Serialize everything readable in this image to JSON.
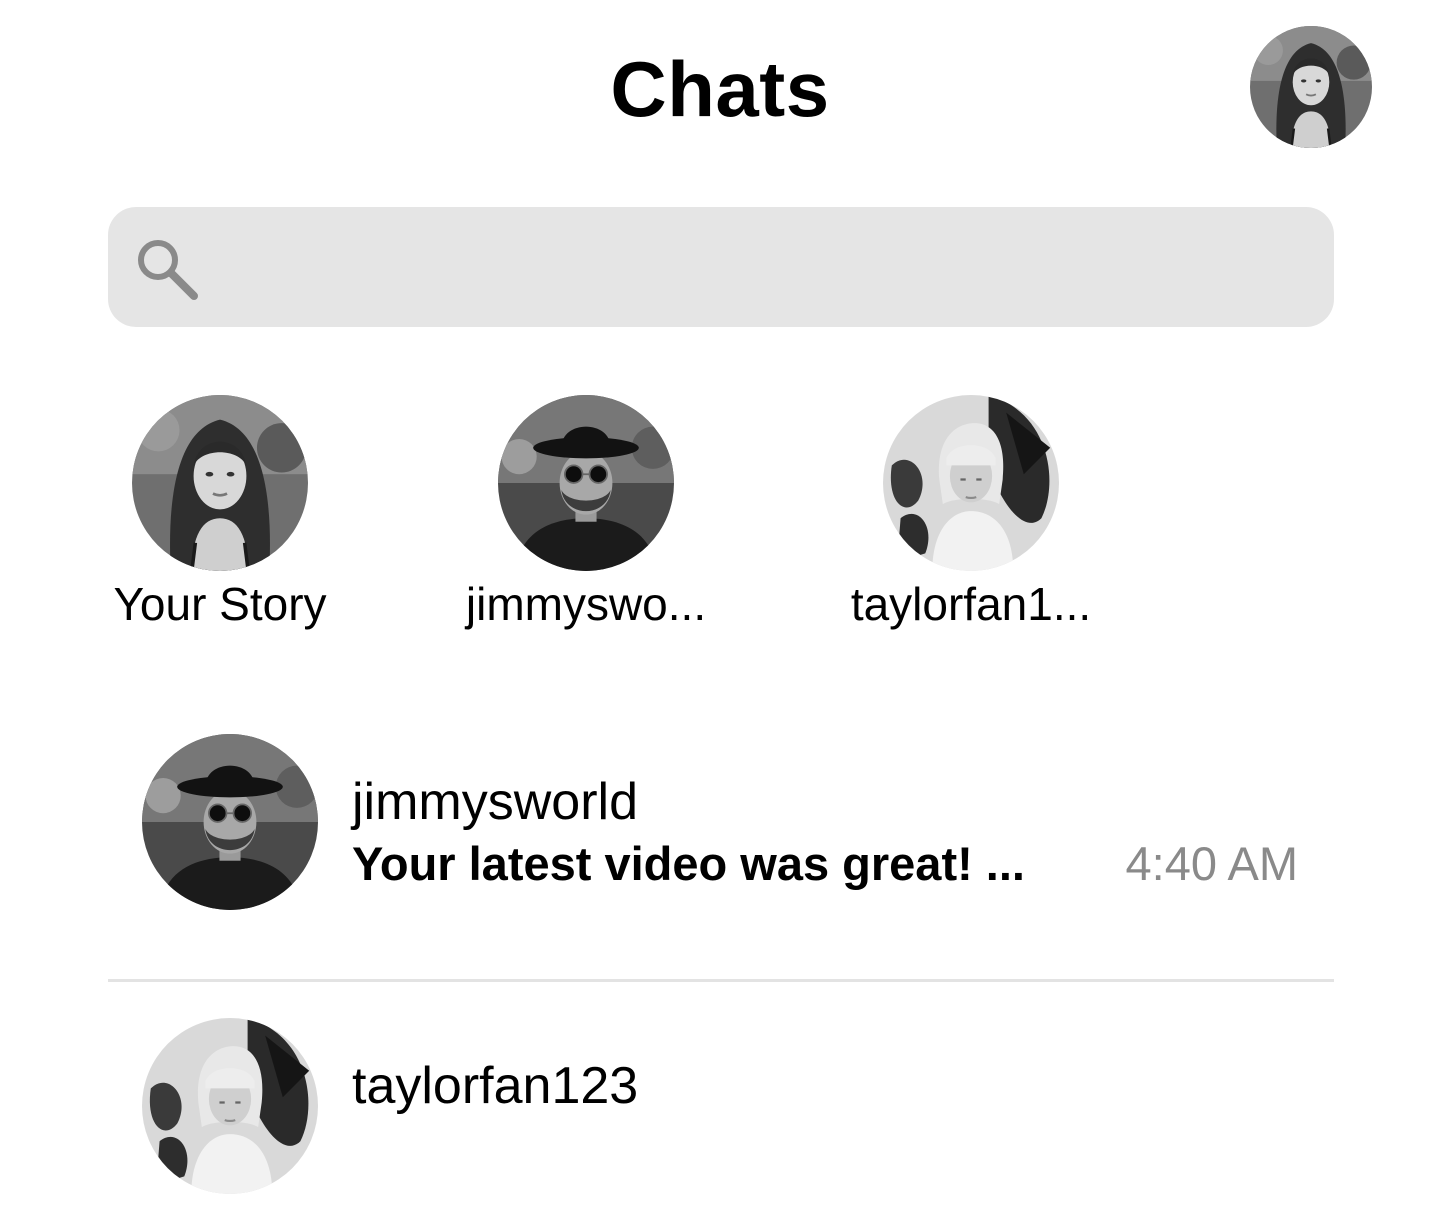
{
  "header": {
    "title": "Chats",
    "profile_avatar": "woman-curly-hair-avatar"
  },
  "search": {
    "placeholder": "",
    "value": "",
    "icon": "search-icon"
  },
  "stories": [
    {
      "label": "Your Story",
      "avatar": "woman-curly-hair-avatar"
    },
    {
      "label": "jimmyswo...",
      "avatar": "man-hat-sunglasses-avatar"
    },
    {
      "label": "taylorfan1...",
      "avatar": "blonde-girl-flowers-avatar"
    }
  ],
  "chats": [
    {
      "name": "jimmysworld",
      "preview": "Your latest video was great! ...",
      "time": "4:40 AM",
      "avatar": "man-hat-sunglasses-avatar"
    },
    {
      "name": "taylorfan123",
      "preview": "",
      "time": "",
      "avatar": "blonde-girl-flowers-avatar"
    }
  ],
  "colors": {
    "search_bg": "#e5e5e5",
    "time_text": "#8a8a8a",
    "divider": "#e3e3e3"
  }
}
